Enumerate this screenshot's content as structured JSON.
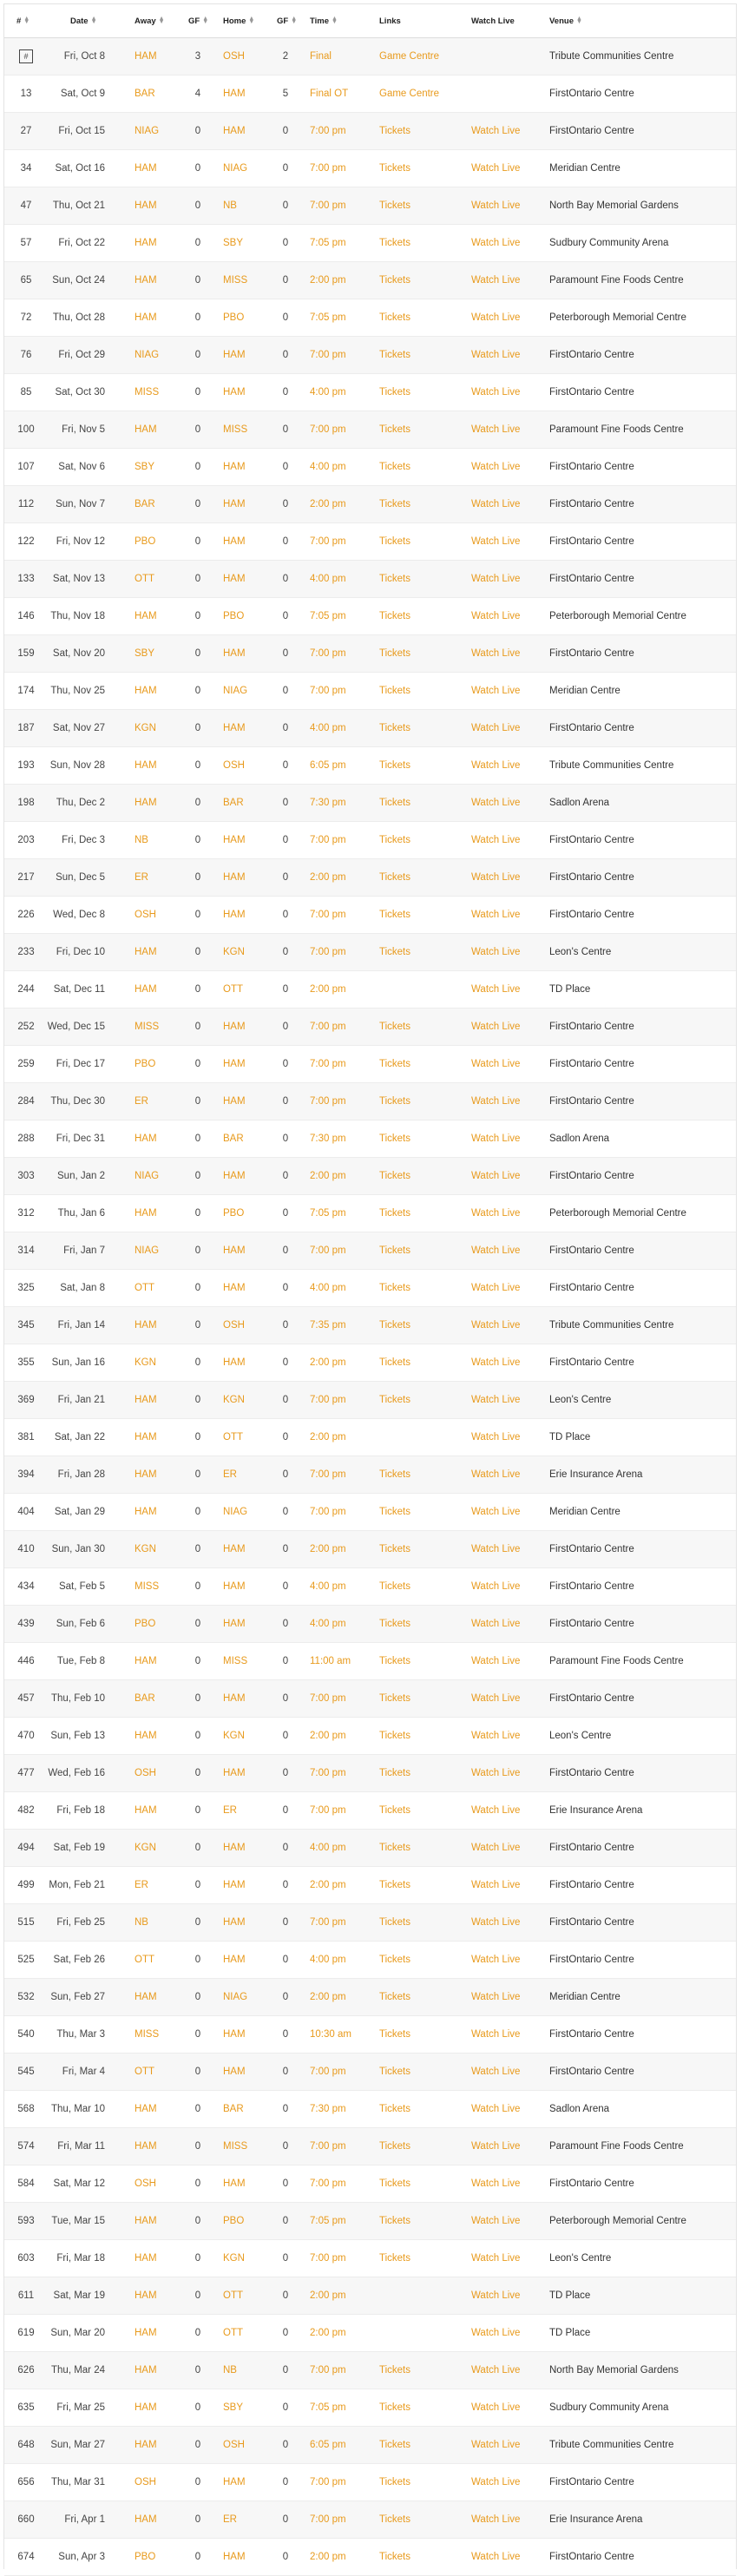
{
  "headers": {
    "num": "#",
    "date": "Date",
    "away": "Away",
    "gf_away": "GF",
    "home": "Home",
    "gf_home": "GF",
    "time": "Time",
    "links": "Links",
    "watch": "Watch Live",
    "venue": "Venue"
  },
  "colors": {
    "link": "#e89a1c",
    "alt_row": "#f7f7f7",
    "text": "#333333"
  },
  "games": [
    {
      "num": "#",
      "date": "Fri, Oct 8",
      "away": "HAM",
      "gf_away": "3",
      "home": "OSH",
      "gf_home": "2",
      "time": "Final",
      "link": "Game Centre",
      "watch": "",
      "venue": "Tribute Communities Centre"
    },
    {
      "num": "13",
      "date": "Sat, Oct 9",
      "away": "BAR",
      "gf_away": "4",
      "home": "HAM",
      "gf_home": "5",
      "time": "Final OT",
      "link": "Game Centre",
      "watch": "",
      "venue": "FirstOntario Centre"
    },
    {
      "num": "27",
      "date": "Fri, Oct 15",
      "away": "NIAG",
      "gf_away": "0",
      "home": "HAM",
      "gf_home": "0",
      "time": "7:00 pm",
      "link": "Tickets",
      "watch": "Watch Live",
      "venue": "FirstOntario Centre"
    },
    {
      "num": "34",
      "date": "Sat, Oct 16",
      "away": "HAM",
      "gf_away": "0",
      "home": "NIAG",
      "gf_home": "0",
      "time": "7:00 pm",
      "link": "Tickets",
      "watch": "Watch Live",
      "venue": "Meridian Centre"
    },
    {
      "num": "47",
      "date": "Thu, Oct 21",
      "away": "HAM",
      "gf_away": "0",
      "home": "NB",
      "gf_home": "0",
      "time": "7:00 pm",
      "link": "Tickets",
      "watch": "Watch Live",
      "venue": "North Bay Memorial Gardens"
    },
    {
      "num": "57",
      "date": "Fri, Oct 22",
      "away": "HAM",
      "gf_away": "0",
      "home": "SBY",
      "gf_home": "0",
      "time": "7:05 pm",
      "link": "Tickets",
      "watch": "Watch Live",
      "venue": "Sudbury Community Arena"
    },
    {
      "num": "65",
      "date": "Sun, Oct 24",
      "away": "HAM",
      "gf_away": "0",
      "home": "MISS",
      "gf_home": "0",
      "time": "2:00 pm",
      "link": "Tickets",
      "watch": "Watch Live",
      "venue": "Paramount Fine Foods Centre"
    },
    {
      "num": "72",
      "date": "Thu, Oct 28",
      "away": "HAM",
      "gf_away": "0",
      "home": "PBO",
      "gf_home": "0",
      "time": "7:05 pm",
      "link": "Tickets",
      "watch": "Watch Live",
      "venue": "Peterborough Memorial Centre"
    },
    {
      "num": "76",
      "date": "Fri, Oct 29",
      "away": "NIAG",
      "gf_away": "0",
      "home": "HAM",
      "gf_home": "0",
      "time": "7:00 pm",
      "link": "Tickets",
      "watch": "Watch Live",
      "venue": "FirstOntario Centre"
    },
    {
      "num": "85",
      "date": "Sat, Oct 30",
      "away": "MISS",
      "gf_away": "0",
      "home": "HAM",
      "gf_home": "0",
      "time": "4:00 pm",
      "link": "Tickets",
      "watch": "Watch Live",
      "venue": "FirstOntario Centre"
    },
    {
      "num": "100",
      "date": "Fri, Nov 5",
      "away": "HAM",
      "gf_away": "0",
      "home": "MISS",
      "gf_home": "0",
      "time": "7:00 pm",
      "link": "Tickets",
      "watch": "Watch Live",
      "venue": "Paramount Fine Foods Centre"
    },
    {
      "num": "107",
      "date": "Sat, Nov 6",
      "away": "SBY",
      "gf_away": "0",
      "home": "HAM",
      "gf_home": "0",
      "time": "4:00 pm",
      "link": "Tickets",
      "watch": "Watch Live",
      "venue": "FirstOntario Centre"
    },
    {
      "num": "112",
      "date": "Sun, Nov 7",
      "away": "BAR",
      "gf_away": "0",
      "home": "HAM",
      "gf_home": "0",
      "time": "2:00 pm",
      "link": "Tickets",
      "watch": "Watch Live",
      "venue": "FirstOntario Centre"
    },
    {
      "num": "122",
      "date": "Fri, Nov 12",
      "away": "PBO",
      "gf_away": "0",
      "home": "HAM",
      "gf_home": "0",
      "time": "7:00 pm",
      "link": "Tickets",
      "watch": "Watch Live",
      "venue": "FirstOntario Centre"
    },
    {
      "num": "133",
      "date": "Sat, Nov 13",
      "away": "OTT",
      "gf_away": "0",
      "home": "HAM",
      "gf_home": "0",
      "time": "4:00 pm",
      "link": "Tickets",
      "watch": "Watch Live",
      "venue": "FirstOntario Centre"
    },
    {
      "num": "146",
      "date": "Thu, Nov 18",
      "away": "HAM",
      "gf_away": "0",
      "home": "PBO",
      "gf_home": "0",
      "time": "7:05 pm",
      "link": "Tickets",
      "watch": "Watch Live",
      "venue": "Peterborough Memorial Centre"
    },
    {
      "num": "159",
      "date": "Sat, Nov 20",
      "away": "SBY",
      "gf_away": "0",
      "home": "HAM",
      "gf_home": "0",
      "time": "7:00 pm",
      "link": "Tickets",
      "watch": "Watch Live",
      "venue": "FirstOntario Centre"
    },
    {
      "num": "174",
      "date": "Thu, Nov 25",
      "away": "HAM",
      "gf_away": "0",
      "home": "NIAG",
      "gf_home": "0",
      "time": "7:00 pm",
      "link": "Tickets",
      "watch": "Watch Live",
      "venue": "Meridian Centre"
    },
    {
      "num": "187",
      "date": "Sat, Nov 27",
      "away": "KGN",
      "gf_away": "0",
      "home": "HAM",
      "gf_home": "0",
      "time": "4:00 pm",
      "link": "Tickets",
      "watch": "Watch Live",
      "venue": "FirstOntario Centre"
    },
    {
      "num": "193",
      "date": "Sun, Nov 28",
      "away": "HAM",
      "gf_away": "0",
      "home": "OSH",
      "gf_home": "0",
      "time": "6:05 pm",
      "link": "Tickets",
      "watch": "Watch Live",
      "venue": "Tribute Communities Centre"
    },
    {
      "num": "198",
      "date": "Thu, Dec 2",
      "away": "HAM",
      "gf_away": "0",
      "home": "BAR",
      "gf_home": "0",
      "time": "7:30 pm",
      "link": "Tickets",
      "watch": "Watch Live",
      "venue": "Sadlon Arena"
    },
    {
      "num": "203",
      "date": "Fri, Dec 3",
      "away": "NB",
      "gf_away": "0",
      "home": "HAM",
      "gf_home": "0",
      "time": "7:00 pm",
      "link": "Tickets",
      "watch": "Watch Live",
      "venue": "FirstOntario Centre"
    },
    {
      "num": "217",
      "date": "Sun, Dec 5",
      "away": "ER",
      "gf_away": "0",
      "home": "HAM",
      "gf_home": "0",
      "time": "2:00 pm",
      "link": "Tickets",
      "watch": "Watch Live",
      "venue": "FirstOntario Centre"
    },
    {
      "num": "226",
      "date": "Wed, Dec 8",
      "away": "OSH",
      "gf_away": "0",
      "home": "HAM",
      "gf_home": "0",
      "time": "7:00 pm",
      "link": "Tickets",
      "watch": "Watch Live",
      "venue": "FirstOntario Centre"
    },
    {
      "num": "233",
      "date": "Fri, Dec 10",
      "away": "HAM",
      "gf_away": "0",
      "home": "KGN",
      "gf_home": "0",
      "time": "7:00 pm",
      "link": "Tickets",
      "watch": "Watch Live",
      "venue": "Leon's Centre"
    },
    {
      "num": "244",
      "date": "Sat, Dec 11",
      "away": "HAM",
      "gf_away": "0",
      "home": "OTT",
      "gf_home": "0",
      "time": "2:00 pm",
      "link": "",
      "watch": "Watch Live",
      "venue": "TD Place"
    },
    {
      "num": "252",
      "date": "Wed, Dec 15",
      "away": "MISS",
      "gf_away": "0",
      "home": "HAM",
      "gf_home": "0",
      "time": "7:00 pm",
      "link": "Tickets",
      "watch": "Watch Live",
      "venue": "FirstOntario Centre"
    },
    {
      "num": "259",
      "date": "Fri, Dec 17",
      "away": "PBO",
      "gf_away": "0",
      "home": "HAM",
      "gf_home": "0",
      "time": "7:00 pm",
      "link": "Tickets",
      "watch": "Watch Live",
      "venue": "FirstOntario Centre"
    },
    {
      "num": "284",
      "date": "Thu, Dec 30",
      "away": "ER",
      "gf_away": "0",
      "home": "HAM",
      "gf_home": "0",
      "time": "7:00 pm",
      "link": "Tickets",
      "watch": "Watch Live",
      "venue": "FirstOntario Centre"
    },
    {
      "num": "288",
      "date": "Fri, Dec 31",
      "away": "HAM",
      "gf_away": "0",
      "home": "BAR",
      "gf_home": "0",
      "time": "7:30 pm",
      "link": "Tickets",
      "watch": "Watch Live",
      "venue": "Sadlon Arena"
    },
    {
      "num": "303",
      "date": "Sun, Jan 2",
      "away": "NIAG",
      "gf_away": "0",
      "home": "HAM",
      "gf_home": "0",
      "time": "2:00 pm",
      "link": "Tickets",
      "watch": "Watch Live",
      "venue": "FirstOntario Centre"
    },
    {
      "num": "312",
      "date": "Thu, Jan 6",
      "away": "HAM",
      "gf_away": "0",
      "home": "PBO",
      "gf_home": "0",
      "time": "7:05 pm",
      "link": "Tickets",
      "watch": "Watch Live",
      "venue": "Peterborough Memorial Centre"
    },
    {
      "num": "314",
      "date": "Fri, Jan 7",
      "away": "NIAG",
      "gf_away": "0",
      "home": "HAM",
      "gf_home": "0",
      "time": "7:00 pm",
      "link": "Tickets",
      "watch": "Watch Live",
      "venue": "FirstOntario Centre"
    },
    {
      "num": "325",
      "date": "Sat, Jan 8",
      "away": "OTT",
      "gf_away": "0",
      "home": "HAM",
      "gf_home": "0",
      "time": "4:00 pm",
      "link": "Tickets",
      "watch": "Watch Live",
      "venue": "FirstOntario Centre"
    },
    {
      "num": "345",
      "date": "Fri, Jan 14",
      "away": "HAM",
      "gf_away": "0",
      "home": "OSH",
      "gf_home": "0",
      "time": "7:35 pm",
      "link": "Tickets",
      "watch": "Watch Live",
      "venue": "Tribute Communities Centre"
    },
    {
      "num": "355",
      "date": "Sun, Jan 16",
      "away": "KGN",
      "gf_away": "0",
      "home": "HAM",
      "gf_home": "0",
      "time": "2:00 pm",
      "link": "Tickets",
      "watch": "Watch Live",
      "venue": "FirstOntario Centre"
    },
    {
      "num": "369",
      "date": "Fri, Jan 21",
      "away": "HAM",
      "gf_away": "0",
      "home": "KGN",
      "gf_home": "0",
      "time": "7:00 pm",
      "link": "Tickets",
      "watch": "Watch Live",
      "venue": "Leon's Centre"
    },
    {
      "num": "381",
      "date": "Sat, Jan 22",
      "away": "HAM",
      "gf_away": "0",
      "home": "OTT",
      "gf_home": "0",
      "time": "2:00 pm",
      "link": "",
      "watch": "Watch Live",
      "venue": "TD Place"
    },
    {
      "num": "394",
      "date": "Fri, Jan 28",
      "away": "HAM",
      "gf_away": "0",
      "home": "ER",
      "gf_home": "0",
      "time": "7:00 pm",
      "link": "Tickets",
      "watch": "Watch Live",
      "venue": "Erie Insurance Arena"
    },
    {
      "num": "404",
      "date": "Sat, Jan 29",
      "away": "HAM",
      "gf_away": "0",
      "home": "NIAG",
      "gf_home": "0",
      "time": "7:00 pm",
      "link": "Tickets",
      "watch": "Watch Live",
      "venue": "Meridian Centre"
    },
    {
      "num": "410",
      "date": "Sun, Jan 30",
      "away": "KGN",
      "gf_away": "0",
      "home": "HAM",
      "gf_home": "0",
      "time": "2:00 pm",
      "link": "Tickets",
      "watch": "Watch Live",
      "venue": "FirstOntario Centre"
    },
    {
      "num": "434",
      "date": "Sat, Feb 5",
      "away": "MISS",
      "gf_away": "0",
      "home": "HAM",
      "gf_home": "0",
      "time": "4:00 pm",
      "link": "Tickets",
      "watch": "Watch Live",
      "venue": "FirstOntario Centre"
    },
    {
      "num": "439",
      "date": "Sun, Feb 6",
      "away": "PBO",
      "gf_away": "0",
      "home": "HAM",
      "gf_home": "0",
      "time": "4:00 pm",
      "link": "Tickets",
      "watch": "Watch Live",
      "venue": "FirstOntario Centre"
    },
    {
      "num": "446",
      "date": "Tue, Feb 8",
      "away": "HAM",
      "gf_away": "0",
      "home": "MISS",
      "gf_home": "0",
      "time": "11:00 am",
      "link": "Tickets",
      "watch": "Watch Live",
      "venue": "Paramount Fine Foods Centre"
    },
    {
      "num": "457",
      "date": "Thu, Feb 10",
      "away": "BAR",
      "gf_away": "0",
      "home": "HAM",
      "gf_home": "0",
      "time": "7:00 pm",
      "link": "Tickets",
      "watch": "Watch Live",
      "venue": "FirstOntario Centre"
    },
    {
      "num": "470",
      "date": "Sun, Feb 13",
      "away": "HAM",
      "gf_away": "0",
      "home": "KGN",
      "gf_home": "0",
      "time": "2:00 pm",
      "link": "Tickets",
      "watch": "Watch Live",
      "venue": "Leon's Centre"
    },
    {
      "num": "477",
      "date": "Wed, Feb 16",
      "away": "OSH",
      "gf_away": "0",
      "home": "HAM",
      "gf_home": "0",
      "time": "7:00 pm",
      "link": "Tickets",
      "watch": "Watch Live",
      "venue": "FirstOntario Centre"
    },
    {
      "num": "482",
      "date": "Fri, Feb 18",
      "away": "HAM",
      "gf_away": "0",
      "home": "ER",
      "gf_home": "0",
      "time": "7:00 pm",
      "link": "Tickets",
      "watch": "Watch Live",
      "venue": "Erie Insurance Arena"
    },
    {
      "num": "494",
      "date": "Sat, Feb 19",
      "away": "KGN",
      "gf_away": "0",
      "home": "HAM",
      "gf_home": "0",
      "time": "4:00 pm",
      "link": "Tickets",
      "watch": "Watch Live",
      "venue": "FirstOntario Centre"
    },
    {
      "num": "499",
      "date": "Mon, Feb 21",
      "away": "ER",
      "gf_away": "0",
      "home": "HAM",
      "gf_home": "0",
      "time": "2:00 pm",
      "link": "Tickets",
      "watch": "Watch Live",
      "venue": "FirstOntario Centre"
    },
    {
      "num": "515",
      "date": "Fri, Feb 25",
      "away": "NB",
      "gf_away": "0",
      "home": "HAM",
      "gf_home": "0",
      "time": "7:00 pm",
      "link": "Tickets",
      "watch": "Watch Live",
      "venue": "FirstOntario Centre"
    },
    {
      "num": "525",
      "date": "Sat, Feb 26",
      "away": "OTT",
      "gf_away": "0",
      "home": "HAM",
      "gf_home": "0",
      "time": "4:00 pm",
      "link": "Tickets",
      "watch": "Watch Live",
      "venue": "FirstOntario Centre"
    },
    {
      "num": "532",
      "date": "Sun, Feb 27",
      "away": "HAM",
      "gf_away": "0",
      "home": "NIAG",
      "gf_home": "0",
      "time": "2:00 pm",
      "link": "Tickets",
      "watch": "Watch Live",
      "venue": "Meridian Centre"
    },
    {
      "num": "540",
      "date": "Thu, Mar 3",
      "away": "MISS",
      "gf_away": "0",
      "home": "HAM",
      "gf_home": "0",
      "time": "10:30 am",
      "link": "Tickets",
      "watch": "Watch Live",
      "venue": "FirstOntario Centre"
    },
    {
      "num": "545",
      "date": "Fri, Mar 4",
      "away": "OTT",
      "gf_away": "0",
      "home": "HAM",
      "gf_home": "0",
      "time": "7:00 pm",
      "link": "Tickets",
      "watch": "Watch Live",
      "venue": "FirstOntario Centre"
    },
    {
      "num": "568",
      "date": "Thu, Mar 10",
      "away": "HAM",
      "gf_away": "0",
      "home": "BAR",
      "gf_home": "0",
      "time": "7:30 pm",
      "link": "Tickets",
      "watch": "Watch Live",
      "venue": "Sadlon Arena"
    },
    {
      "num": "574",
      "date": "Fri, Mar 11",
      "away": "HAM",
      "gf_away": "0",
      "home": "MISS",
      "gf_home": "0",
      "time": "7:00 pm",
      "link": "Tickets",
      "watch": "Watch Live",
      "venue": "Paramount Fine Foods Centre"
    },
    {
      "num": "584",
      "date": "Sat, Mar 12",
      "away": "OSH",
      "gf_away": "0",
      "home": "HAM",
      "gf_home": "0",
      "time": "7:00 pm",
      "link": "Tickets",
      "watch": "Watch Live",
      "venue": "FirstOntario Centre"
    },
    {
      "num": "593",
      "date": "Tue, Mar 15",
      "away": "HAM",
      "gf_away": "0",
      "home": "PBO",
      "gf_home": "0",
      "time": "7:05 pm",
      "link": "Tickets",
      "watch": "Watch Live",
      "venue": "Peterborough Memorial Centre"
    },
    {
      "num": "603",
      "date": "Fri, Mar 18",
      "away": "HAM",
      "gf_away": "0",
      "home": "KGN",
      "gf_home": "0",
      "time": "7:00 pm",
      "link": "Tickets",
      "watch": "Watch Live",
      "venue": "Leon's Centre"
    },
    {
      "num": "611",
      "date": "Sat, Mar 19",
      "away": "HAM",
      "gf_away": "0",
      "home": "OTT",
      "gf_home": "0",
      "time": "2:00 pm",
      "link": "",
      "watch": "Watch Live",
      "venue": "TD Place"
    },
    {
      "num": "619",
      "date": "Sun, Mar 20",
      "away": "HAM",
      "gf_away": "0",
      "home": "OTT",
      "gf_home": "0",
      "time": "2:00 pm",
      "link": "",
      "watch": "Watch Live",
      "venue": "TD Place"
    },
    {
      "num": "626",
      "date": "Thu, Mar 24",
      "away": "HAM",
      "gf_away": "0",
      "home": "NB",
      "gf_home": "0",
      "time": "7:00 pm",
      "link": "Tickets",
      "watch": "Watch Live",
      "venue": "North Bay Memorial Gardens"
    },
    {
      "num": "635",
      "date": "Fri, Mar 25",
      "away": "HAM",
      "gf_away": "0",
      "home": "SBY",
      "gf_home": "0",
      "time": "7:05 pm",
      "link": "Tickets",
      "watch": "Watch Live",
      "venue": "Sudbury Community Arena"
    },
    {
      "num": "648",
      "date": "Sun, Mar 27",
      "away": "HAM",
      "gf_away": "0",
      "home": "OSH",
      "gf_home": "0",
      "time": "6:05 pm",
      "link": "Tickets",
      "watch": "Watch Live",
      "venue": "Tribute Communities Centre"
    },
    {
      "num": "656",
      "date": "Thu, Mar 31",
      "away": "OSH",
      "gf_away": "0",
      "home": "HAM",
      "gf_home": "0",
      "time": "7:00 pm",
      "link": "Tickets",
      "watch": "Watch Live",
      "venue": "FirstOntario Centre"
    },
    {
      "num": "660",
      "date": "Fri, Apr 1",
      "away": "HAM",
      "gf_away": "0",
      "home": "ER",
      "gf_home": "0",
      "time": "7:00 pm",
      "link": "Tickets",
      "watch": "Watch Live",
      "venue": "Erie Insurance Arena"
    },
    {
      "num": "674",
      "date": "Sun, Apr 3",
      "away": "PBO",
      "gf_away": "0",
      "home": "HAM",
      "gf_home": "0",
      "time": "2:00 pm",
      "link": "Tickets",
      "watch": "Watch Live",
      "venue": "FirstOntario Centre"
    }
  ]
}
